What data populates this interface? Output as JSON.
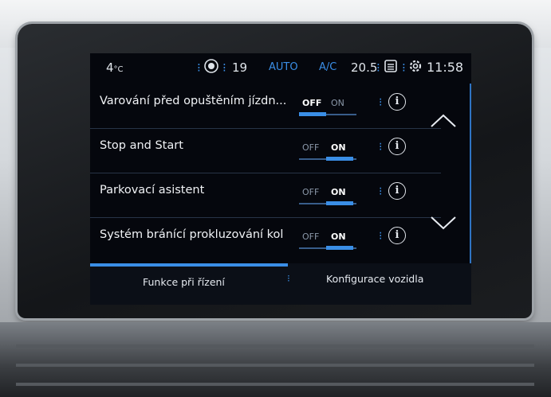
{
  "status_bar": {
    "outside_temp": "4",
    "outside_temp_unit": "°C",
    "fan_level": "19",
    "auto_label": "AUTO",
    "ac_label": "A/C",
    "cabin_temp": "20.5",
    "clock": "11:58"
  },
  "settings": [
    {
      "label": "Varování před opuštěním jízdn...",
      "off_label": "OFF",
      "on_label": "ON",
      "state": "OFF"
    },
    {
      "label": "Stop and Start",
      "off_label": "OFF",
      "on_label": "ON",
      "state": "ON"
    },
    {
      "label": "Parkovací asistent",
      "off_label": "OFF",
      "on_label": "ON",
      "state": "ON"
    },
    {
      "label": "Systém bránící prokluzování kol",
      "off_label": "OFF",
      "on_label": "ON",
      "state": "ON"
    }
  ],
  "tabs": [
    {
      "label": "Funkce při řízení",
      "active": true
    },
    {
      "label": "Konfigurace vozidla",
      "active": false
    }
  ],
  "colors": {
    "accent": "#3a8ee6",
    "screen_bg": "#05070d",
    "text": "#f1f3f6"
  },
  "icons": [
    "fan-icon",
    "seat-heat-icon",
    "settings-gear-icon",
    "info-icon",
    "chevron-up-icon",
    "chevron-down-icon"
  ]
}
